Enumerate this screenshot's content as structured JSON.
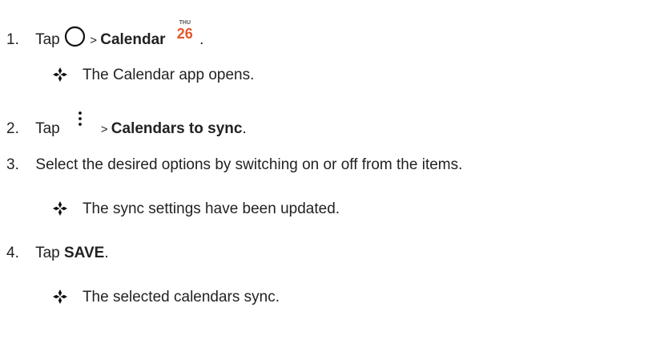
{
  "steps": [
    {
      "number": "1.",
      "verb": "Tap",
      "separator": ">",
      "target": "Calendar",
      "icon_before": "home-circle-icon",
      "icon_after": "calendar-app-icon",
      "trailing": ".",
      "result": "The Calendar app opens."
    },
    {
      "number": "2.",
      "verb": "Tap",
      "separator": ">",
      "target": "Calendars to sync",
      "icon_before": "more-options-icon",
      "trailing": "."
    },
    {
      "number": "3.",
      "text": "Select the desired options by switching on or off from the items.",
      "result": "The sync settings have been updated."
    },
    {
      "number": "4.",
      "verb": "Tap",
      "target": "SAVE",
      "trailing": ".",
      "result": "The selected calendars sync."
    }
  ],
  "calendar_icon": {
    "day": "THU",
    "date": "26"
  },
  "colors": {
    "text": "#222222",
    "calendar_date": "#e4572e"
  }
}
